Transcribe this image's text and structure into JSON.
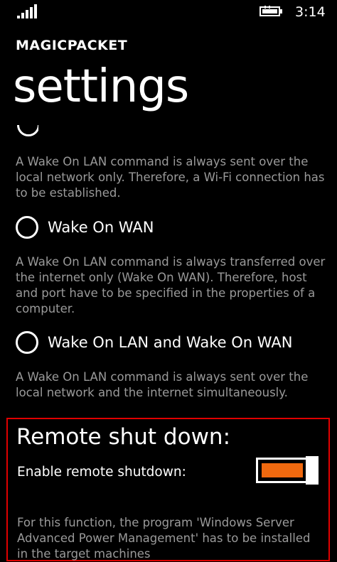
{
  "status_bar": {
    "time": "3:14",
    "signal_icon": "signal-strength-icon",
    "battery_icon": "battery-charging-icon"
  },
  "header": {
    "app_name": "MAGICPACKET",
    "page_title": "settings"
  },
  "options": {
    "lan_description": "A Wake On LAN command is always sent over the local network only. Therefore, a Wi-Fi connection has to be established.",
    "wan": {
      "label": "Wake On WAN",
      "description": "A Wake On LAN command is always transferred over the internet only (Wake On WAN). Therefore, host and port have to be specified in the properties of a computer."
    },
    "lan_and_wan": {
      "label": "Wake On LAN and Wake On WAN",
      "description": "A Wake On LAN command is always sent over the local network and the internet simultaneously."
    }
  },
  "remote_shutdown": {
    "title": "Remote shut down:",
    "toggle_label": "Enable remote shutdown:",
    "enabled": true,
    "description": "For this function, the program 'Windows Server Advanced Power Management' has to be installed in the target machines"
  },
  "colors": {
    "accent": "#f0690f",
    "highlight_border": "#e00000",
    "secondary_text": "#9a9a9a"
  }
}
